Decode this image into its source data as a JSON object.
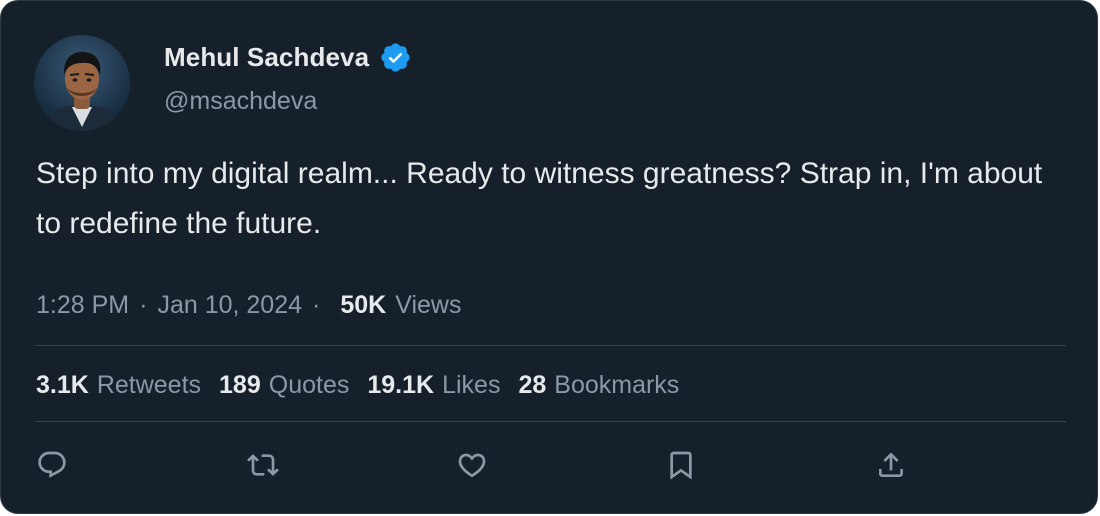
{
  "author": {
    "name": "Mehul Sachdeva",
    "handle": "@msachdeva",
    "verified": true,
    "verified_color": "#1d9bf0"
  },
  "tweet": {
    "text": "Step into my digital realm... Ready to witness greatness? Strap in, I'm about to redefine the future.",
    "time": "1:28 PM",
    "date": "Jan 10, 2024",
    "separator": "·",
    "views_count": "50K",
    "views_label": "Views"
  },
  "stats": {
    "retweets_count": "3.1K",
    "retweets_label": "Retweets",
    "quotes_count": "189",
    "quotes_label": "Quotes",
    "likes_count": "19.1K",
    "likes_label": "Likes",
    "bookmarks_count": "28",
    "bookmarks_label": "Bookmarks"
  },
  "actions": [
    {
      "icon": "reply-icon"
    },
    {
      "icon": "retweet-icon"
    },
    {
      "icon": "like-icon"
    },
    {
      "icon": "bookmark-icon"
    },
    {
      "icon": "share-icon"
    }
  ],
  "colors": {
    "background": "#15202b",
    "primary_text": "#e7e9ea",
    "secondary_text": "#8b98a5",
    "divider": "#38444d"
  }
}
